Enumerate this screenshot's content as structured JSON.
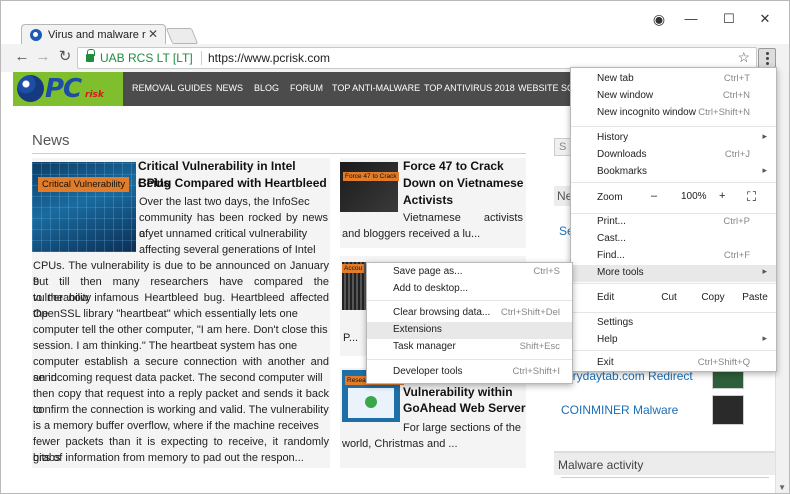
{
  "browser": {
    "tab_title": "Virus and malware remo",
    "tab_close": "✕",
    "cert_label": "UAB RCS LT [LT]",
    "url": "https://www.pcrisk.com",
    "icons": {
      "back": "←",
      "forward": "→",
      "reload": "↻",
      "star": "☆",
      "profile": "◉",
      "minimize": "—",
      "maximize": "☐",
      "close": "✕"
    }
  },
  "site": {
    "logo_main": "PC",
    "logo_sub": "risk",
    "nav": [
      "REMOVAL GUIDES",
      "NEWS",
      "BLOG",
      "FORUM",
      "TOP ANTI-MALWARE",
      "TOP ANTIVIRUS 2018",
      "WEBSITE SCA"
    ],
    "news_heading": "News",
    "articles": [
      {
        "thumb_label": "Critical Vulnerability",
        "title_line1": "Critical Vulnerability in Intel CPUs",
        "title_line2": "Being Compared with Heartbleed",
        "body_lines": [
          "Over the last two days, the InfoSec",
          "community has been rocked by news of",
          "a yet unnamed critical vulnerability",
          "affecting several generations of Intel",
          "CPUs. The vulnerability is due to be announced on January 9",
          "but till then many researchers have compared the vulnerability",
          "to the now infamous Heartbleed bug. Heartbleed affected the",
          "OpenSSL library \"heartbeat\" which essentially lets one",
          "computer tell the other computer, \"I am here. Don't close this",
          "session. I am thinking.\" The heartbeat system has one",
          "computer establish a secure connection with another and send",
          "an incoming request data packet. The second computer will",
          "then copy that request into a reply packet and sends it back to",
          "confirm the connection is working and valid. The vulnerability",
          "is a memory buffer overflow, where if the machine receives",
          "fewer packets than it is expecting to receive, it randomly grabs",
          "bits of information from memory to pad out the respon..."
        ]
      },
      {
        "thumb_label": "Force 47 to Crack",
        "title_lines": [
          "Force 47 to Crack",
          "Down on Vietnamese",
          "Activists"
        ],
        "body_lines": [
          "Vietnamese activists",
          "and bloggers received a lu..."
        ]
      },
      {
        "thumb_label": "Accou",
        "body_lines": [
          "P..."
        ]
      },
      {
        "thumb_label": "Researchers Disco",
        "title_lines": [
          "Vulnerability within",
          "GoAhead Web Server"
        ],
        "body_lines": [
          "For large sections of the",
          "world, Christmas and ..."
        ]
      }
    ],
    "sidebar": {
      "search_stub": "S",
      "section_stub": "Ne",
      "link_stub": "Se",
      "links": [
        "erydaytab.com Redirect",
        "COINMINER Malware"
      ],
      "malware_activity": "Malware activity"
    }
  },
  "chrome_menu": {
    "items": [
      {
        "label": "New tab",
        "shortcut": "Ctrl+T"
      },
      {
        "label": "New window",
        "shortcut": "Ctrl+N"
      },
      {
        "label": "New incognito window",
        "shortcut": "Ctrl+Shift+N"
      },
      {
        "label": "History",
        "shortcut": ""
      },
      {
        "label": "Downloads",
        "shortcut": "Ctrl+J"
      },
      {
        "label": "Bookmarks",
        "shortcut": ""
      },
      {
        "label": "Print...",
        "shortcut": "Ctrl+P"
      },
      {
        "label": "Cast...",
        "shortcut": ""
      },
      {
        "label": "Find...",
        "shortcut": "Ctrl+F"
      },
      {
        "label": "More tools",
        "shortcut": ""
      },
      {
        "label": "Settings",
        "shortcut": ""
      },
      {
        "label": "Help",
        "shortcut": ""
      },
      {
        "label": "Exit",
        "shortcut": "Ctrl+Shift+Q"
      }
    ],
    "zoom": {
      "label": "Zoom",
      "minus": "–",
      "value": "100%",
      "plus": "+",
      "fullscreen": "⛶"
    },
    "edit": {
      "label": "Edit",
      "cut": "Cut",
      "copy": "Copy",
      "paste": "Paste"
    },
    "arrow": "▸"
  },
  "more_tools_menu": {
    "items": [
      {
        "label": "Save page as...",
        "shortcut": "Ctrl+S"
      },
      {
        "label": "Add to desktop...",
        "shortcut": ""
      },
      {
        "label": "Clear browsing data...",
        "shortcut": "Ctrl+Shift+Del"
      },
      {
        "label": "Extensions",
        "shortcut": ""
      },
      {
        "label": "Task manager",
        "shortcut": "Shift+Esc"
      },
      {
        "label": "Developer tools",
        "shortcut": "Ctrl+Shift+I"
      }
    ],
    "highlighted": "Extensions"
  }
}
